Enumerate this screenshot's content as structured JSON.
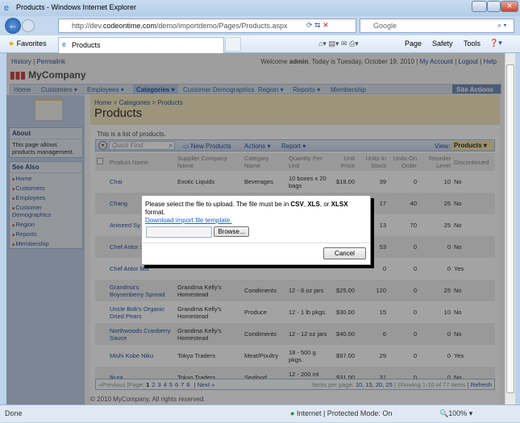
{
  "window": {
    "title": "Products - Windows Internet Explorer"
  },
  "browser": {
    "url_prefix": "http://dev.",
    "url_domain": "codeontime.com",
    "url_path": "/demo/importdemo/Pages/Products.aspx",
    "search_placeholder": "Google",
    "favorites": "Favorites",
    "tab": "Products",
    "page_menu": "Page",
    "safety_menu": "Safety",
    "tools_menu": "Tools"
  },
  "top": {
    "history": "History",
    "permalink": "Permalink",
    "welcome": "Welcome ",
    "user": "admin",
    "date": ", Today is Tuesday, October 19, 2010",
    "my_account": "My Account",
    "logout": "Logout",
    "help": "Help"
  },
  "logo": "MyCompany",
  "menu": [
    "Home",
    "Customers ▾",
    "Employees ▾",
    "Categories ▾",
    "Customer Demographics",
    "Region ▾",
    "Reports ▾",
    "Membership"
  ],
  "site_actions": "Site Actions ▾",
  "sidebar": {
    "about_title": "About",
    "about_text": "This page allows products management.",
    "see_also_title": "See Also",
    "links": [
      "Home",
      "Customers",
      "Employees",
      "Customer Demographics",
      "Region",
      "Reports",
      "Membership"
    ]
  },
  "breadcrumb": "Home > Categories > Products",
  "page_title": "Products",
  "description": "This is a list of products.",
  "toolbar": {
    "quick_find": "Quick Find",
    "new": "New Products",
    "actions": "Actions ▾",
    "report": "Report ▾",
    "view_label": "View:",
    "view": "Products ▾"
  },
  "columns": [
    "Product Name",
    "Supplier Company Name",
    "Category Name",
    "Quantity Per Unit",
    "Unit Price",
    "Units In Stock",
    "Units On Order",
    "Reorder Level",
    "Discontinued"
  ],
  "rows": [
    [
      "Chai",
      "Exotic Liquids",
      "Beverages",
      "10 boxes x 20 bags",
      "$18.00",
      "39",
      "0",
      "10",
      "No"
    ],
    [
      "Chang",
      "",
      "",
      "",
      "",
      "17",
      "40",
      "25",
      "No"
    ],
    [
      "Aniseed Sy",
      "",
      "",
      "",
      "",
      "13",
      "70",
      "25",
      "No"
    ],
    [
      "Chef Antor Seasoning",
      "",
      "",
      "",
      "",
      "53",
      "0",
      "0",
      "No"
    ],
    [
      "Chef Antor Mix",
      "",
      "",
      "",
      "",
      "0",
      "0",
      "0",
      "Yes"
    ],
    [
      "Grandma's Boysenberry Spread",
      "Grandma Kelly's Homestead",
      "Condiments",
      "12 - 8 oz jars",
      "$25.00",
      "120",
      "0",
      "25",
      "No"
    ],
    [
      "Uncle Bob's Organic Dried Pears",
      "Grandma Kelly's Homestead",
      "Produce",
      "12 - 1 lb pkgs.",
      "$30.00",
      "15",
      "0",
      "10",
      "No"
    ],
    [
      "Northwoods Cranberry Sauce",
      "Grandma Kelly's Homestead",
      "Condiments",
      "12 - 12 oz jars",
      "$40.00",
      "6",
      "0",
      "0",
      "No"
    ],
    [
      "Mishi Kobe Niku",
      "Tokyo Traders",
      "Meat/Poultry",
      "18 - 500 g pkgs.",
      "$97.00",
      "29",
      "0",
      "0",
      "Yes"
    ],
    [
      "Ikura",
      "Tokyo Traders",
      "Seafood",
      "12 - 200 ml jars",
      "$31.00",
      "31",
      "0",
      "0",
      "No"
    ]
  ],
  "pager": {
    "prev": "«Previous",
    "page_label": "|Page:",
    "pages": [
      "1",
      "2",
      "3",
      "4",
      "5",
      "6",
      "7",
      "8"
    ],
    "next": "| Next »",
    "items_per_page": "Items per page: ",
    "sizes": "10, 15, 20, 25",
    "showing": "| Showing 1-10 of 77 items",
    "refresh": "| Refresh"
  },
  "footer": "© 2010 MyCompany. All rights reserved.",
  "modal": {
    "text_a": "Please select the file to upload. The file must be in ",
    "csv": "CSV",
    "comma": ", ",
    "xls": "XLS",
    "or": ", or ",
    "xlsx": "XLSX",
    "text_b": " format.",
    "template_link": "Download import file template.",
    "browse": "Browse...",
    "cancel": "Cancel"
  },
  "status": {
    "done": "Done",
    "zone": "Internet | Protected Mode: On",
    "zoom": "100%"
  }
}
